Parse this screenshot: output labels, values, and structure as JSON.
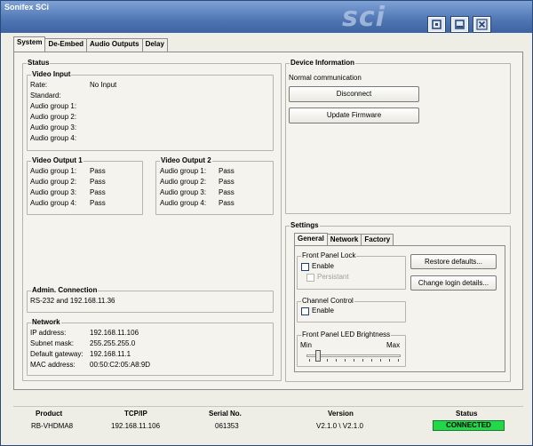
{
  "window": {
    "title": "Sonifex SCi",
    "logo": "sci"
  },
  "tabs": [
    "System",
    "De-Embed",
    "Audio Outputs",
    "Delay"
  ],
  "status": {
    "caption": "Status",
    "video_input": {
      "caption": "Video Input",
      "rows": [
        {
          "label": "Rate:",
          "value": "No Input"
        },
        {
          "label": "Standard:",
          "value": ""
        },
        {
          "label": "Audio group 1:",
          "value": ""
        },
        {
          "label": "Audio group 2:",
          "value": ""
        },
        {
          "label": "Audio group 3:",
          "value": ""
        },
        {
          "label": "Audio group 4:",
          "value": ""
        }
      ]
    },
    "video_output_1": {
      "caption": "Video Output 1",
      "rows": [
        {
          "label": "Audio group 1:",
          "value": "Pass"
        },
        {
          "label": "Audio group 2:",
          "value": "Pass"
        },
        {
          "label": "Audio group 3:",
          "value": "Pass"
        },
        {
          "label": "Audio group 4:",
          "value": "Pass"
        }
      ]
    },
    "video_output_2": {
      "caption": "Video Output 2",
      "rows": [
        {
          "label": "Audio group 1:",
          "value": "Pass"
        },
        {
          "label": "Audio group 2:",
          "value": "Pass"
        },
        {
          "label": "Audio group 3:",
          "value": "Pass"
        },
        {
          "label": "Audio group 4:",
          "value": "Pass"
        }
      ]
    }
  },
  "admin": {
    "caption": "Admin. Connection",
    "text": "RS-232 and 192.168.11.36"
  },
  "network": {
    "caption": "Network",
    "rows": [
      {
        "label": "IP address:",
        "value": "192.168.11.106"
      },
      {
        "label": "Subnet mask:",
        "value": "255.255.255.0"
      },
      {
        "label": "Default gateway:",
        "value": "192.168.11.1"
      },
      {
        "label": "MAC address:",
        "value": "00:50:C2:05:A8:9D"
      }
    ]
  },
  "device": {
    "caption": "Device Information",
    "status_text": "Normal communication",
    "disconnect_label": "Disconnect",
    "update_label": "Update Firmware"
  },
  "settings": {
    "caption": "Settings",
    "tabs": [
      "General",
      "Network",
      "Factory"
    ],
    "front_panel_lock": {
      "caption": "Front Panel Lock",
      "enable": "Enable",
      "persistant": "Persistant"
    },
    "channel_control": {
      "caption": "Channel Control",
      "enable": "Enable"
    },
    "brightness": {
      "caption": "Front Panel LED Brightness",
      "min": "Min",
      "max": "Max",
      "level": 0.1
    },
    "restore_label": "Restore defaults...",
    "login_label": "Change login details..."
  },
  "statusbar": {
    "product_h": "Product",
    "product_v": "RB-VHDMA8",
    "tcpip_h": "TCP/IP",
    "tcpip_v": "192.168.11.106",
    "serial_h": "Serial No.",
    "serial_v": "061353",
    "version_h": "Version",
    "version_v": "V2.1.0 \\ V2.1.0",
    "status_h": "Status",
    "status_v": "CONNECTED"
  },
  "colors": {
    "connected": "#22d84a",
    "titlebar": "#4f75b3"
  }
}
